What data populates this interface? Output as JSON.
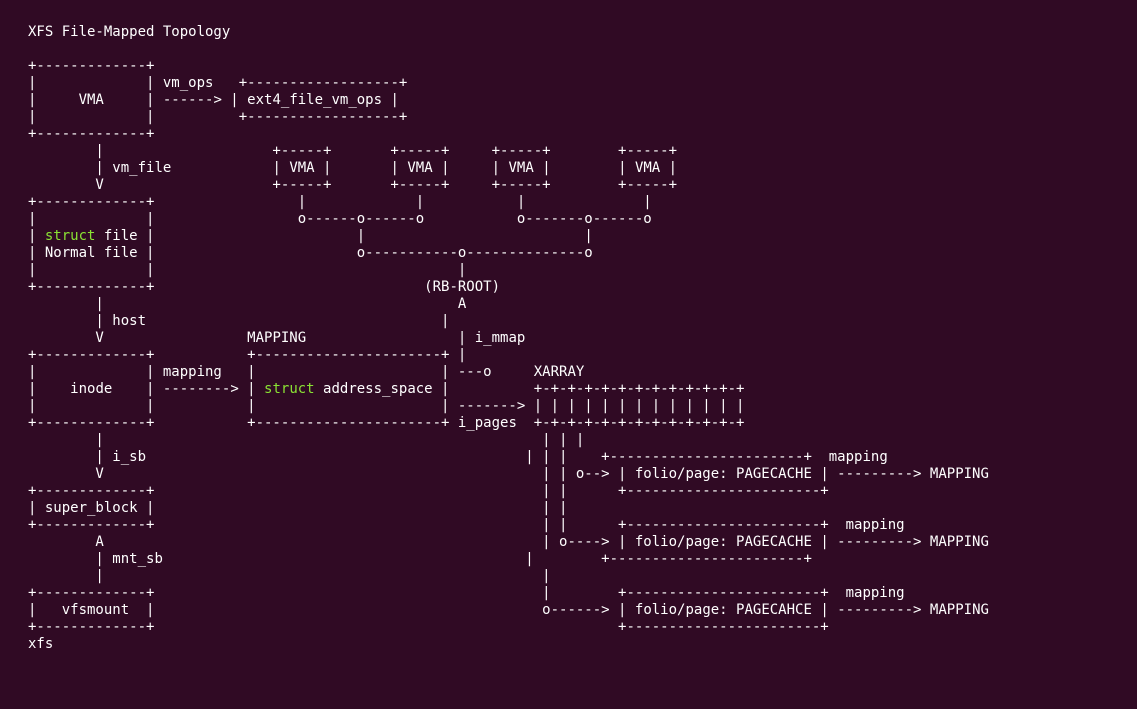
{
  "title": "XFS File-Mapped Topology",
  "kw": {
    "struct1": "struct",
    "struct2": "struct"
  },
  "labels": {
    "vma": "VMA",
    "vm_ops": "vm_ops",
    "ext4_file_vm_ops": "ext4_file_vm_ops",
    "vm_file": "vm_file",
    "file_suffix": " file",
    "normal_file": "Normal file",
    "host": "host",
    "mapping_caps": "MAPPING",
    "i_mmap": "i_mmap",
    "rb_root": "(RB-ROOT)",
    "inode": "inode",
    "mapping": "mapping",
    "address_space_suffix": " address_space",
    "xarray": "XARRAY",
    "i_pages": "i_pages",
    "i_sb": "i_sb",
    "folio_page_pagecache": "folio/page: PAGECACHE",
    "folio_page_pagecahce": "folio/page: PAGECAHCE",
    "mapping_dest": "MAPPING",
    "super_block": "super_block",
    "mnt_sb": "mnt_sb",
    "vfsmount": "vfsmount",
    "xfs": "xfs"
  }
}
